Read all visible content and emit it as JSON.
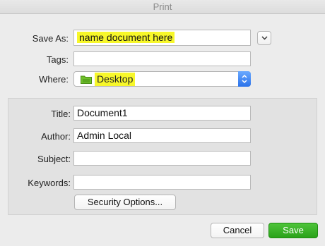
{
  "window": {
    "title": "Print"
  },
  "form": {
    "save_as_label": "Save As:",
    "save_as_value": "name document here",
    "tags_label": "Tags:",
    "tags_value": "",
    "where_label": "Where:",
    "where_value": "Desktop",
    "where_icon": "folder-icon"
  },
  "properties": {
    "title_label": "Title:",
    "title_value": "Document1",
    "author_label": "Author:",
    "author_value": "Admin Local",
    "subject_label": "Subject:",
    "subject_value": "",
    "keywords_label": "Keywords:",
    "keywords_value": "",
    "security_button": "Security Options..."
  },
  "footer": {
    "cancel_label": "Cancel",
    "save_label": "Save"
  },
  "colors": {
    "highlight": "#f7f72a",
    "save_button": "#2aa21a",
    "stepper": "#2b72ea"
  }
}
